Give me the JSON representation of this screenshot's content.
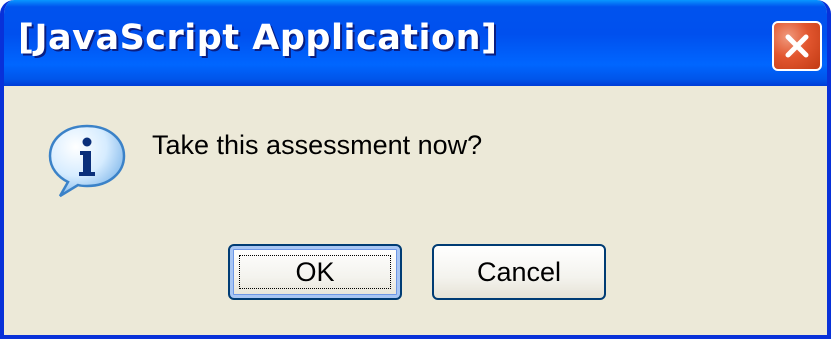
{
  "dialog": {
    "title": "[JavaScript Application]",
    "message": "Take this assessment now?",
    "ok_label": "OK",
    "cancel_label": "Cancel",
    "icon": "info-icon",
    "close_icon": "close-icon"
  },
  "colors": {
    "titlebar": "#0054e3",
    "body": "#ece9d8",
    "close_button": "#e2562f",
    "button_border": "#003c74"
  }
}
